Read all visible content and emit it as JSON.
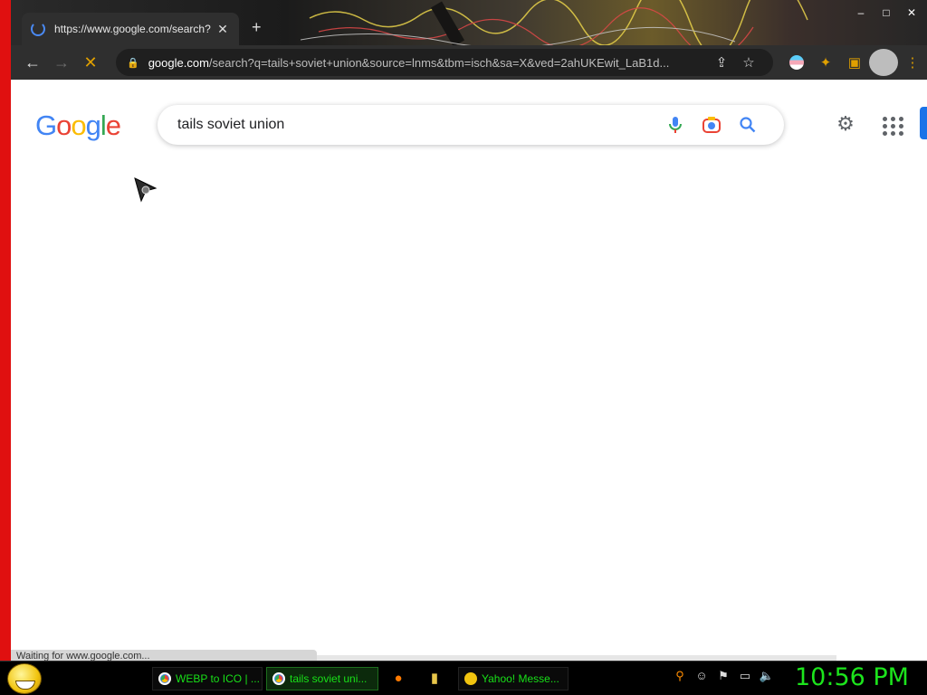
{
  "browser": {
    "tab_title": "https://www.google.com/search?",
    "new_tab_symbol": "+",
    "url_host": "google.com",
    "url_path": "/search?q=tails+soviet+union&source=lnms&tbm=isch&sa=X&ved=2ahUKEwit_LaB1d...",
    "window_controls": [
      "–",
      "□",
      "✕"
    ]
  },
  "google": {
    "logo_letters": [
      "G",
      "o",
      "o",
      "g",
      "l",
      "e"
    ],
    "search_value": "tails soviet union"
  },
  "status_bar": {
    "text": "Waiting for www.google.com..."
  },
  "taskbar": {
    "items": [
      {
        "label": "WEBP to ICO | ..."
      },
      {
        "label": "tails soviet uni..."
      },
      {
        "label": "Yahoo! Messe..."
      }
    ],
    "clock": "10:56 PM"
  },
  "colors": {
    "google_blue": "#4285f4",
    "google_red": "#ea4335",
    "google_yellow": "#fbbc05",
    "google_green": "#34a853",
    "taskbar_text": "#18e018",
    "clock": "#1ce41c",
    "desktop_red": "#e01010"
  }
}
